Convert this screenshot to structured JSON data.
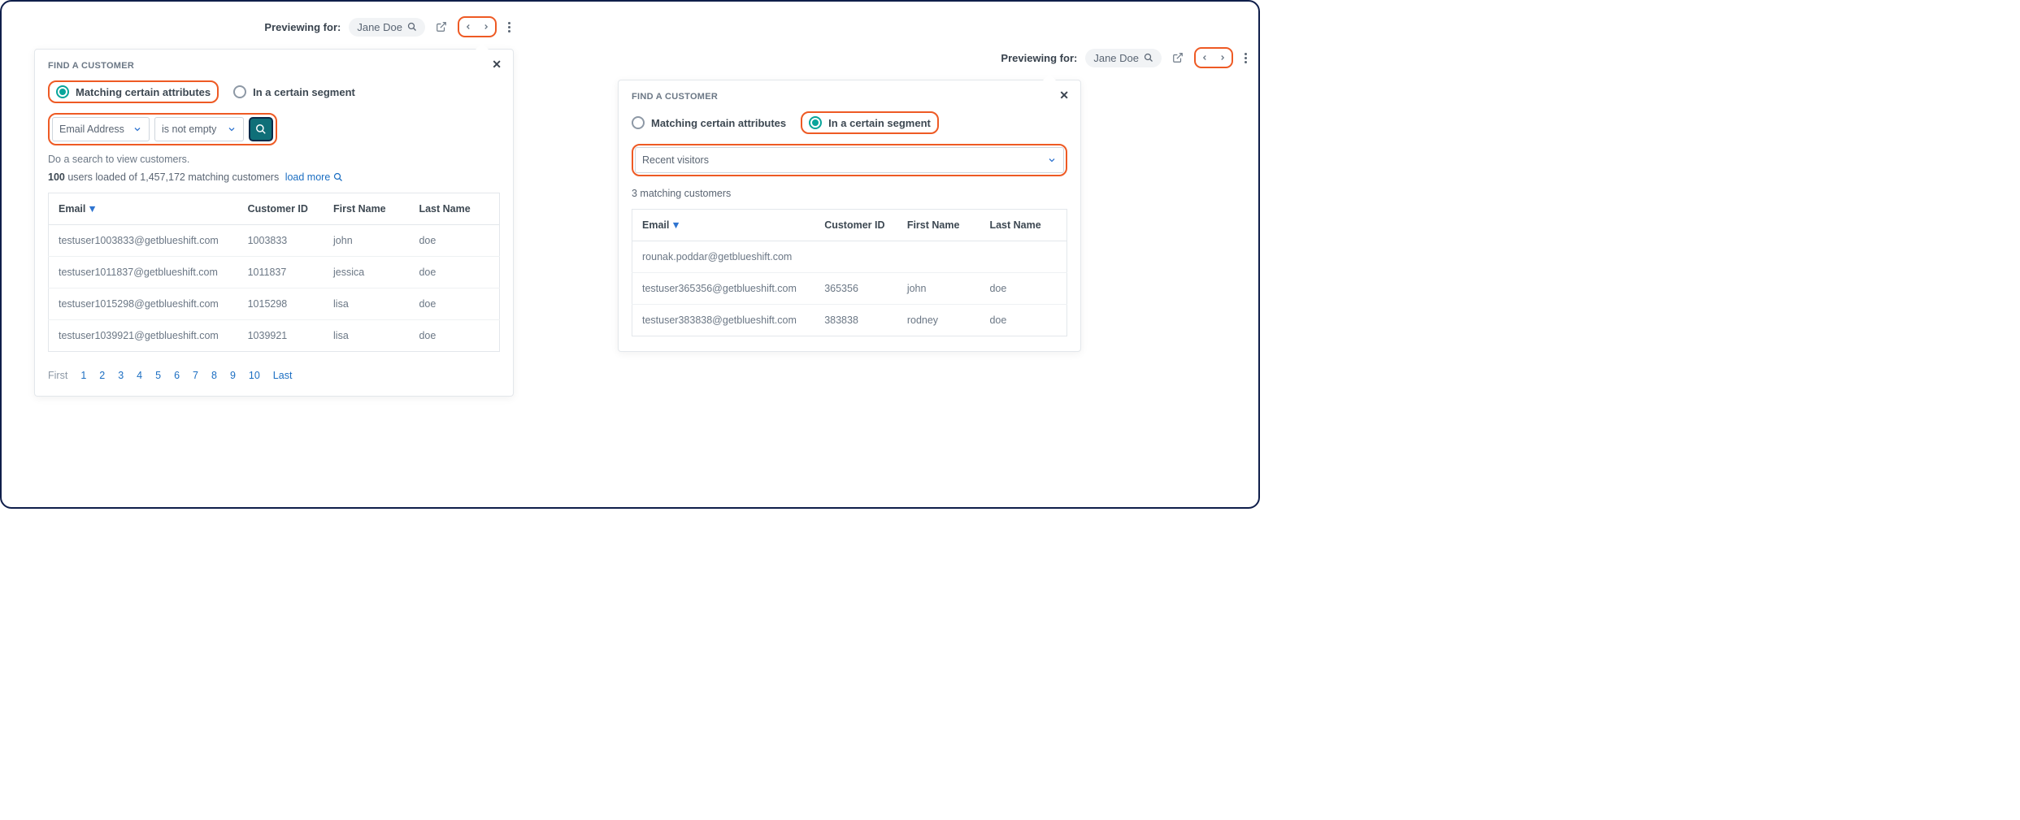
{
  "left": {
    "preview": {
      "label": "Previewing for:",
      "name": "Jane Doe"
    },
    "panel": {
      "title": "FIND A CUSTOMER",
      "radio_attr": "Matching certain attributes",
      "radio_seg": "In a certain segment",
      "field": "Email Address",
      "operator": "is not empty",
      "hint": "Do a search to view customers.",
      "count_loaded": "100",
      "count_text_mid": " users loaded of 1,457,172 matching customers",
      "load_more": "load more",
      "columns": {
        "email": "Email",
        "cid": "Customer ID",
        "first": "First Name",
        "last": "Last Name"
      },
      "rows": [
        {
          "email": "testuser1003833@getblueshift.com",
          "cid": "1003833",
          "first": "john",
          "last": "doe"
        },
        {
          "email": "testuser1011837@getblueshift.com",
          "cid": "1011837",
          "first": "jessica",
          "last": "doe"
        },
        {
          "email": "testuser1015298@getblueshift.com",
          "cid": "1015298",
          "first": "lisa",
          "last": "doe"
        },
        {
          "email": "testuser1039921@getblueshift.com",
          "cid": "1039921",
          "first": "lisa",
          "last": "doe"
        }
      ],
      "pager": {
        "first": "First",
        "pages": [
          "1",
          "2",
          "3",
          "4",
          "5",
          "6",
          "7",
          "8",
          "9",
          "10"
        ],
        "last": "Last"
      }
    }
  },
  "right": {
    "preview": {
      "label": "Previewing for:",
      "name": "Jane Doe"
    },
    "panel": {
      "title": "FIND A CUSTOMER",
      "radio_attr": "Matching certain attributes",
      "radio_seg": "In a certain segment",
      "segment": "Recent visitors",
      "count": "3 matching customers",
      "columns": {
        "email": "Email",
        "cid": "Customer ID",
        "first": "First Name",
        "last": "Last Name"
      },
      "rows": [
        {
          "email": "rounak.poddar@getblueshift.com",
          "cid": "",
          "first": "",
          "last": ""
        },
        {
          "email": "testuser365356@getblueshift.com",
          "cid": "365356",
          "first": "john",
          "last": "doe"
        },
        {
          "email": "testuser383838@getblueshift.com",
          "cid": "383838",
          "first": "rodney",
          "last": "doe"
        }
      ]
    }
  }
}
